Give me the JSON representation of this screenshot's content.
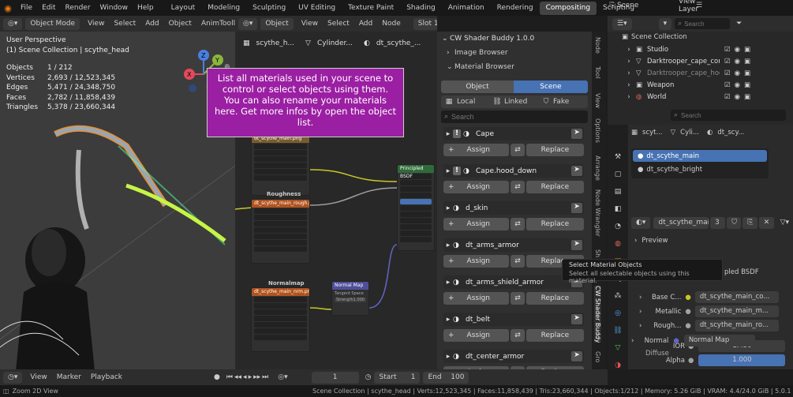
{
  "topbar": {
    "menus": [
      "File",
      "Edit",
      "Render",
      "Window",
      "Help"
    ],
    "workspaces": [
      "Layout",
      "Modeling",
      "Sculpting",
      "UV Editing",
      "Texture Paint",
      "Shading",
      "Animation",
      "Rendering",
      "Compositing",
      "Scripting"
    ],
    "active_workspace": "Compositing",
    "scene": "Scene",
    "view_layer": "View Layer"
  },
  "viewport": {
    "mode": "Object Mode",
    "menus": [
      "View",
      "Select",
      "Add",
      "Object",
      "AnimTooll"
    ],
    "perspective": "User Perspective",
    "collection": "(1) Scene Collection | scythe_head",
    "stats": [
      {
        "k": "Objects",
        "v": "1 / 212"
      },
      {
        "k": "Vertices",
        "v": "2,693 / 12,523,345"
      },
      {
        "k": "Edges",
        "v": "5,471 / 24,348,750"
      },
      {
        "k": "Faces",
        "v": "2,782 / 11,858,439"
      },
      {
        "k": "Triangles",
        "v": "5,378 / 23,660,344"
      }
    ],
    "gizmo": {
      "x": "X",
      "y": "Y",
      "z": "Z"
    }
  },
  "tooltip_banner": {
    "text": "List all materials used in your scene to control or select objects using them. You can also rename your materials here. Get more infos by open the object list."
  },
  "node_editor": {
    "type": "Object",
    "menus": [
      "View",
      "Select",
      "Add",
      "Node"
    ],
    "slot": "Slot 1",
    "material": "dt_scythe_main",
    "users": "3",
    "breadcrumb": [
      "scythe_h...",
      "Cylinder...",
      "dt_scythe_..."
    ],
    "nodes": {
      "roughness": "Roughness",
      "normalmap": "Normalmap",
      "principled": "Principled BSDF",
      "normal_map": "Normal Map",
      "img1": "dt_scythe_main.png",
      "img2": "dt_scythe_main_rough.png",
      "img3": "dt_scythe_main_nrm.png",
      "tangent": "Tangent Space",
      "strength": "Strength",
      "strength_val": "1.000"
    }
  },
  "addon": {
    "title": "CW Shader Buddy 1.0.0",
    "image_browser": "Image Browser",
    "material_browser": "Material Browser",
    "tabs": [
      "Object",
      "Scene"
    ],
    "active_tab": "Scene",
    "filters": [
      "Local",
      "Linked",
      "Fake"
    ],
    "search_placeholder": "Search",
    "assign": "Assign",
    "replace": "Replace",
    "materials": [
      "Cape",
      "Cape.hood_down",
      "d_skin",
      "dt_arms_armor",
      "dt_arms_shield_armor",
      "dt_belt",
      "dt_center_armor"
    ]
  },
  "hover_tip": {
    "title": "Select Material Objects",
    "body": "Select all selectable objects using this material."
  },
  "sidebar_tabs": [
    "Node",
    "Tool",
    "View",
    "Options",
    "Arrange",
    "Node Wrangler",
    "Sh",
    "CW Shader Buddy",
    "Gro"
  ],
  "outliner": {
    "search_placeholder": "Search",
    "root": "Scene Collection",
    "items": [
      "Studio",
      "Darktrooper_cape_con",
      "Darktrooper_cape_hoc",
      "Weapon",
      "World"
    ]
  },
  "properties": {
    "breadcrumb": [
      "scyt...",
      "Cyli...",
      "dt_scy..."
    ],
    "search_placeholder": "Search",
    "slots": [
      "dt_scythe_main",
      "dt_scythe_bright"
    ],
    "material": "dt_scythe_main",
    "users": "3",
    "preview": "Preview",
    "bsdf_partial": "pled BSDF",
    "rows": [
      {
        "k": "Base C...",
        "v": "dt_scythe_main_co..."
      },
      {
        "k": "Metallic",
        "v": "dt_scythe_main_m..."
      },
      {
        "k": "Rough...",
        "v": "dt_scythe_main_ro..."
      }
    ],
    "ior_label": "IOR",
    "ior": "1.450",
    "alpha_label": "Alpha",
    "alpha": "1.000",
    "normal_label": "Normal",
    "normal": "Normal Map",
    "diffuse": "Diffuse"
  },
  "timeline": {
    "menus": [
      "View",
      "Marker",
      "Playback"
    ],
    "frame": "1",
    "start_label": "Start",
    "start": "1",
    "end_label": "End",
    "end": "100"
  },
  "statusbar": {
    "left": "Zoom 2D View",
    "center": "Scene Collection | scythe_head | Verts:12,523,345 | Faces:11,858,439 | Tris:23,660,344 | Objects:1/212 | Memory: 5.26 GiB | VRAM: 4.4/24.0 GiB | 5.0.1"
  },
  "colors": {
    "accent": "#4772b3",
    "banner": "#9b1fa3",
    "link_yellow": "#c7c729",
    "link_purple": "#6363c7",
    "link_gray": "#a1a1a1"
  }
}
